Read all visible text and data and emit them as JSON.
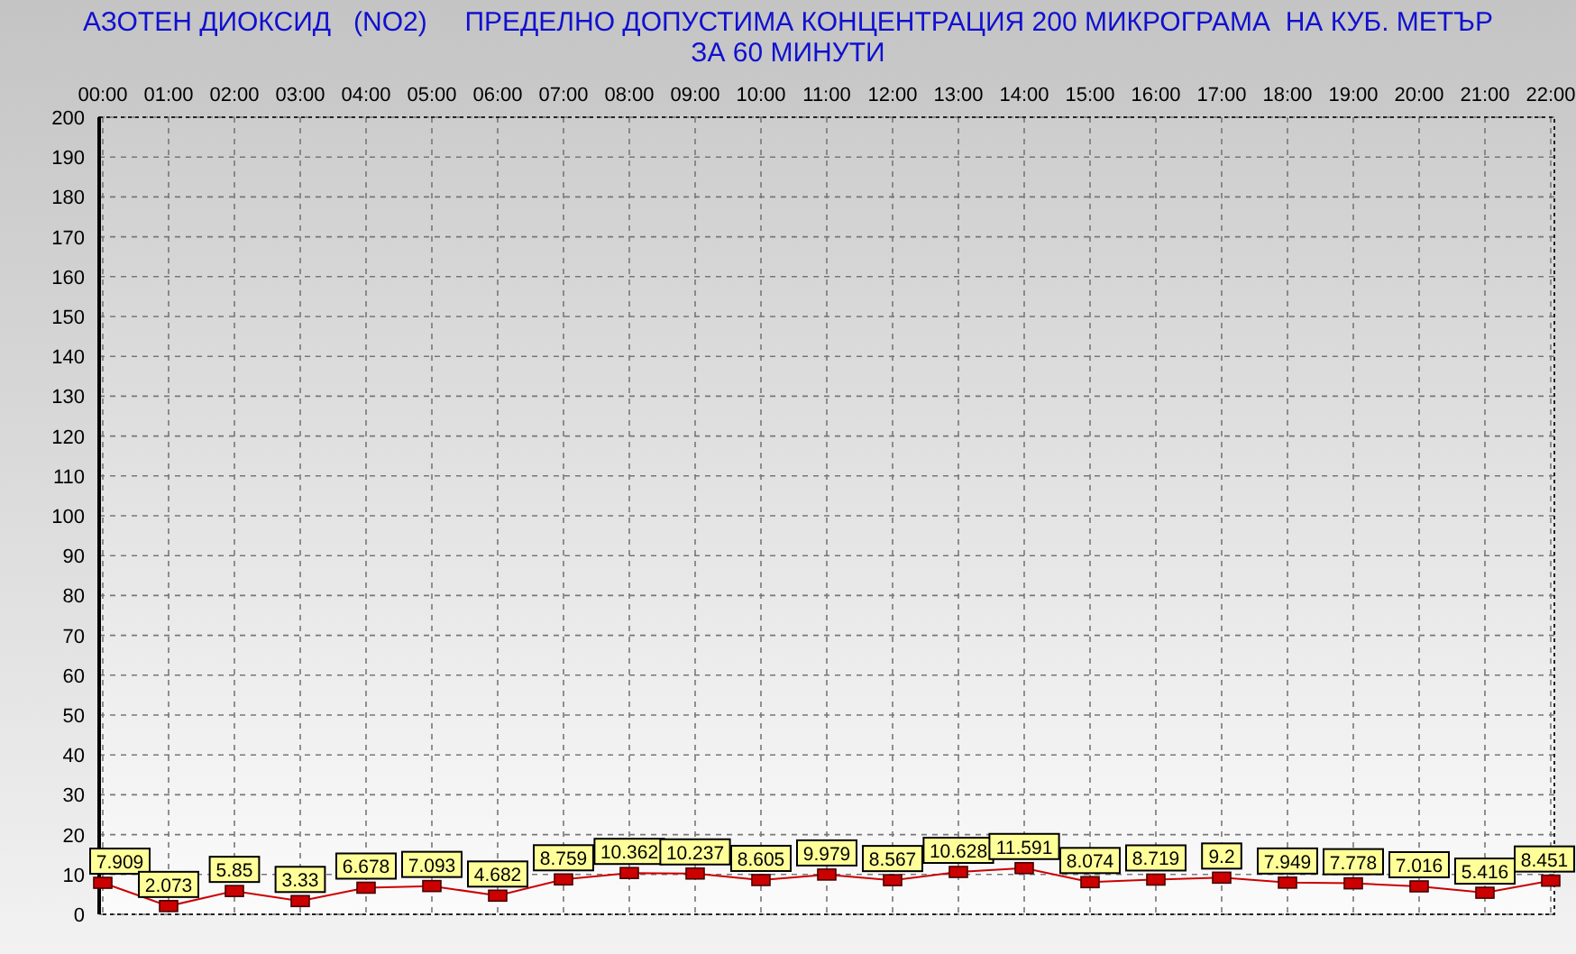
{
  "title": "АЗОТЕН ДИОКСИД   (NO2)     ПРЕДЕЛНО ДОПУСТИМА КОНЦЕНТРАЦИЯ 200 МИКРОГРАМА  НА КУБ. МЕТЪР",
  "subtitle": "ЗА 60 МИНУТИ",
  "chart_data": {
    "type": "line",
    "categories": [
      "00:00",
      "01:00",
      "02:00",
      "03:00",
      "04:00",
      "05:00",
      "06:00",
      "07:00",
      "08:00",
      "09:00",
      "10:00",
      "11:00",
      "12:00",
      "13:00",
      "14:00",
      "15:00",
      "16:00",
      "17:00",
      "18:00",
      "19:00",
      "20:00",
      "21:00",
      "22:00"
    ],
    "series": [
      {
        "color": "#cc0000",
        "marker": "square",
        "values": [
          7.909,
          2.073,
          5.85,
          3.33,
          6.678,
          7.093,
          4.682,
          8.759,
          10.362,
          10.237,
          8.605,
          9.979,
          8.567,
          10.628,
          11.591,
          8.074,
          8.719,
          9.2,
          7.949,
          7.778,
          7.016,
          5.416,
          8.451
        ]
      }
    ],
    "ylim": [
      0,
      200
    ],
    "yticks": [
      0,
      10,
      20,
      30,
      40,
      50,
      60,
      70,
      80,
      90,
      100,
      110,
      120,
      130,
      140,
      150,
      160,
      170,
      180,
      190,
      200
    ],
    "grid": true,
    "data_labels": true
  }
}
